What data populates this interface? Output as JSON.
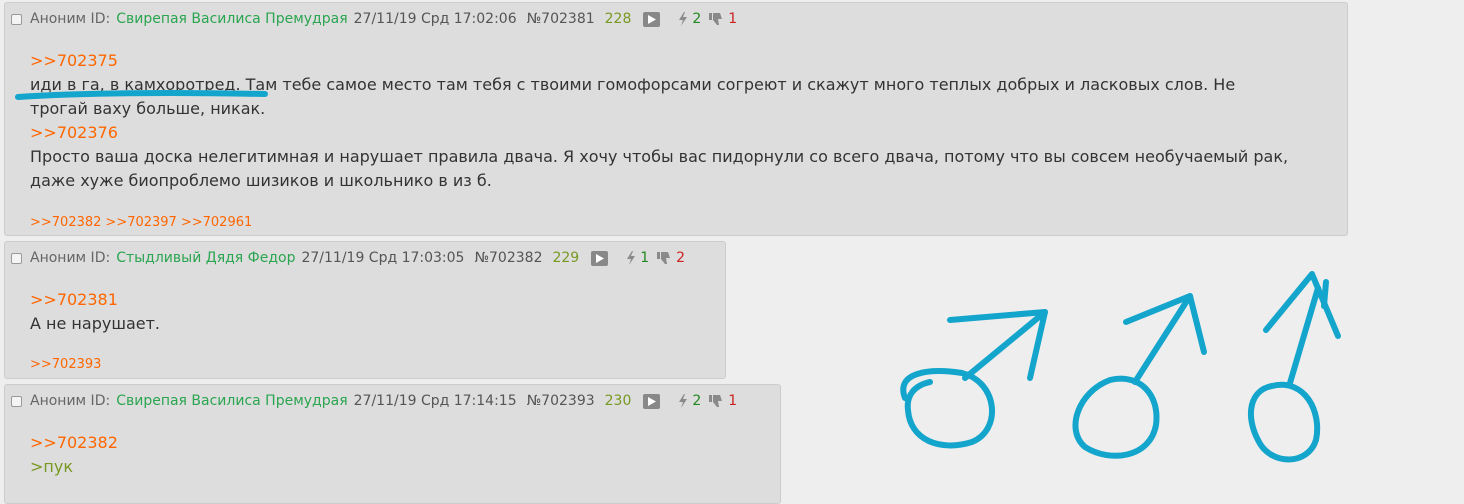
{
  "posts": [
    {
      "anon_label": "Аноним ID:",
      "id_name": "Свирепая Василиса Премудрая",
      "date": "27/11/19 Срд 17:02:06",
      "num": "№702381",
      "count": "228",
      "likes": "2",
      "dislikes": "1",
      "lines": [
        ">>702375",
        "иди в га, в камхоротред. Там тебе самое место там тебя с твоими гомофорсами согреют и скажут много теплых добрых и ласковых слов. Не",
        "трогай ваху больше, никак.",
        ">>702376",
        "Просто ваша доска нелегитимная и нарушает правила двача. Я хочу чтобы вас пидорнули со всего двача, потому что вы совсем необучаемый рак,",
        "даже хуже биопроблемо шизиков и школьнико в из б."
      ],
      "replies": [
        ">>702382",
        ">>702397",
        ">>702961"
      ]
    },
    {
      "anon_label": "Аноним ID:",
      "id_name": "Стыдливый Дядя Федор",
      "date": "27/11/19 Срд 17:03:05",
      "num": "№702382",
      "count": "229",
      "likes": "1",
      "dislikes": "2",
      "lines": [
        ">>702381",
        "А не нарушает."
      ],
      "replies": [
        ">>702393"
      ]
    },
    {
      "anon_label": "Аноним ID:",
      "id_name": "Свирепая Василиса Премудрая",
      "date": "27/11/19 Срд 17:14:15",
      "num": "№702393",
      "count": "230",
      "likes": "2",
      "dislikes": "1",
      "lines": [
        ">>702382",
        ">пук"
      ],
      "replies": []
    }
  ],
  "colors": {
    "link": "#ff6600",
    "greentext": "#789922",
    "id_name": "#2aa550",
    "drawing": "#13a5cc"
  },
  "overlay_drawing": "hand-drawn blue underline and three male symbols"
}
